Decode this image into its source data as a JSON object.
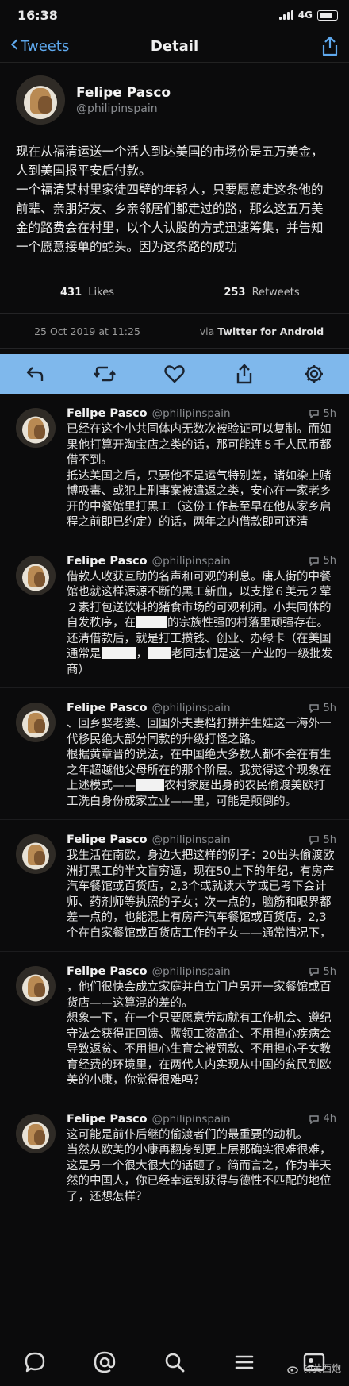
{
  "status": {
    "time": "16:38",
    "network": "4G"
  },
  "nav": {
    "back_label": "Tweets",
    "title": "Detail",
    "share_icon": "share-icon"
  },
  "main_tweet": {
    "name": "Felipe Pasco",
    "handle": "@philipinspain",
    "text": "现在从福清运送一个活人到达美国的市场价是五万美金，人到美国报平安后付款。\n一个福清某村里家徒四壁的年轻人，只要愿意走这条他的前辈、亲朋好友、乡亲邻居们都走过的路，那么这五万美金的路费会在村里，以个人认股的方式迅速筹集，并告知一个愿意接单的蛇头。因为这条路的成功",
    "likes_count": "431",
    "likes_label": "Likes",
    "retweets_count": "253",
    "retweets_label": "Retweets",
    "date": "25 Oct 2019 at 11:25",
    "via_prefix": "via",
    "via_app": "Twitter for Android"
  },
  "actions": [
    "reply-icon",
    "retweet-icon",
    "like-icon",
    "share-icon",
    "settings-icon"
  ],
  "replies": [
    {
      "name": "Felipe Pasco",
      "handle": "@philipinspain",
      "time": "5h",
      "text": "已经在这个小共同体内无数次被验证可以复制。而如果他打算开淘宝店之类的话，那可能连５千人民币都借不到。\n抵达美国之后，只要他不是运气特别差，诸如染上赌博吸毒、或犯上刑事案被遣返之类，安心在一家老乡开的中餐馆里打黑工（这份工作甚至早在他从家乡启程之前即已约定）的话，两年之内借款即可还清"
    },
    {
      "name": "Felipe Pasco",
      "handle": "@philipinspain",
      "time": "5h",
      "text_a": "借款人收获互助的名声和可观的利息。唐人街的中餐馆也就这样源源不断的黑工新血，以支撑６美元２荤２素打包送饮料的猪食市场的可观利润。小共同体的自发秩序，在",
      "text_b": "的宗族性强的村落里顽强存在。\n还清借款后，就是打工攒钱、创业、办绿卡（在美国通常是",
      "text_c": "，",
      "text_d": "老同志们是这一产业的一级批发商）"
    },
    {
      "name": "Felipe Pasco",
      "handle": "@philipinspain",
      "time": "5h",
      "text_a": "、回乡娶老婆、回国外夫妻档打拼并生娃这一海外一代移民绝大部分同款的升级打怪之路。\n根据黄章晋的说法，在中国绝大多数人都不会在有生之年超越他父母所在的那个阶层。我觉得这个现象在上述模式——",
      "text_b": "农村家庭出身的农民偷渡美欧打工洗白身份成家立业——里，可能是颠倒的。"
    },
    {
      "name": "Felipe Pasco",
      "handle": "@philipinspain",
      "time": "5h",
      "text": "我生活在南欧，身边大把这样的例子：20出头偷渡欧洲打黑工的半文盲穷逼，现在50上下的年纪，有房产汽车餐馆或百货店，2,3个或就读大学或已考下会计师、药剂师等执照的子女；次一点的，脑筋和眼界都差一点的，也能混上有房产汽车餐馆或百货店，2,3个在自家餐馆或百货店工作的子女——通常情况下，"
    },
    {
      "name": "Felipe Pasco",
      "handle": "@philipinspain",
      "time": "5h",
      "text": "，他们很快会成立家庭并自立门户另开一家餐馆或百货店——这算混的差的。\n想象一下，在一个只要愿意劳动就有工作机会、遵纪守法会获得正回馈、蓝领工资高企、不用担心疾病会导致返贫、不用担心生育会被罚款、不用担心子女教育经费的环境里，在两代人内实现从中国的贫民到欧美的小康，你觉得很难吗？"
    },
    {
      "name": "Felipe Pasco",
      "handle": "@philipinspain",
      "time": "4h",
      "text": "这可能是前仆后继的偷渡者们的最重要的动机。\n当然从欧美的小康再翻身到更上层那确实很难很难，这是另一个很大很大的话题了。简而言之，作为半天然的中国人，你已经幸运到获得与德性不匹配的地位了，还想怎样？"
    }
  ],
  "tabbar": [
    "home-chat-icon",
    "mentions-icon",
    "search-icon",
    "lists-icon",
    "profile-icon"
  ],
  "watermark": "@黄西炮",
  "colors": {
    "accent": "#5fa9ee",
    "action_bar": "#7fb8ec",
    "background": "#0b0b0c"
  }
}
